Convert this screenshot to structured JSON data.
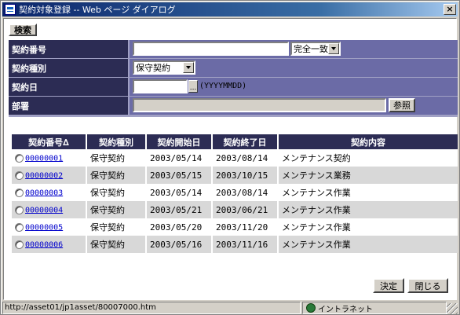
{
  "window": {
    "title": "契約対象登録 -- Web ページ ダイアログ",
    "close_glyph": "×"
  },
  "toolbar": {
    "search_label": "検索"
  },
  "form": {
    "contract_number": {
      "label": "契約番号",
      "value": "",
      "match_select": "完全一致"
    },
    "contract_type": {
      "label": "契約種別",
      "select": "保守契約"
    },
    "contract_date": {
      "label": "契約日",
      "value": "",
      "picker_label": "...",
      "format_hint": "(YYYYMMDD)"
    },
    "department": {
      "label": "部署",
      "value": "",
      "browse_label": "参照"
    }
  },
  "table": {
    "headers": [
      "契約番号∆",
      "契約種別",
      "契約開始日",
      "契約終了日",
      "契約内容"
    ],
    "rows": [
      {
        "id": "00000001",
        "type": "保守契約",
        "start": "2003/05/14",
        "end": "2003/08/14",
        "content": "メンテナンス契約"
      },
      {
        "id": "00000002",
        "type": "保守契約",
        "start": "2003/05/15",
        "end": "2003/10/15",
        "content": "メンテナンス業務"
      },
      {
        "id": "00000003",
        "type": "保守契約",
        "start": "2003/05/14",
        "end": "2003/08/14",
        "content": "メンテナンス作業"
      },
      {
        "id": "00000004",
        "type": "保守契約",
        "start": "2003/05/21",
        "end": "2003/06/21",
        "content": "メンテナンス作業"
      },
      {
        "id": "00000005",
        "type": "保守契約",
        "start": "2003/05/20",
        "end": "2003/11/20",
        "content": "メンテナンス作業"
      },
      {
        "id": "00000006",
        "type": "保守契約",
        "start": "2003/05/16",
        "end": "2003/11/16",
        "content": "メンテナンス作業"
      }
    ]
  },
  "footer": {
    "ok_label": "決定",
    "close_label": "閉じる"
  },
  "statusbar": {
    "url": "http://asset01/jp1asset/80007000.htm",
    "zone": "イントラネット"
  },
  "colors": {
    "header_dark": "#2c2c54",
    "form_field_bg": "#6b6ba6",
    "form_bg": "#a0a0c4",
    "row_alt": "#d8d8d8",
    "link": "#0000cc",
    "titlebar": "#0a246a"
  }
}
